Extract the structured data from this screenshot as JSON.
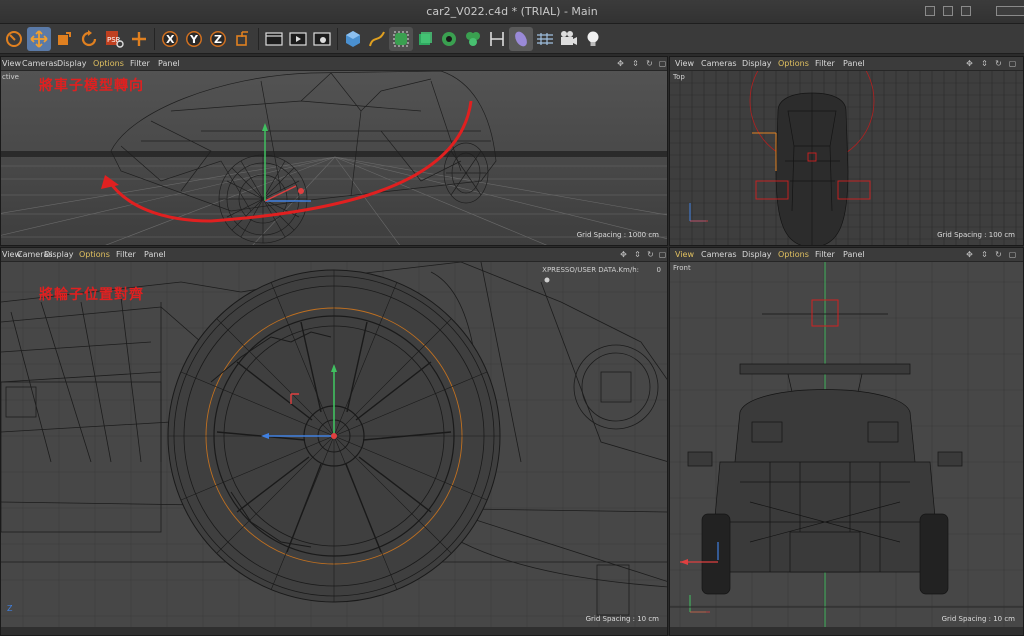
{
  "window": {
    "title": "car2_V022.c4d * (TRIAL) - Main"
  },
  "toolbar": {
    "tools": [
      {
        "name": "live-selection-icon",
        "active": false
      },
      {
        "name": "move-icon",
        "active": true
      },
      {
        "name": "scale-icon",
        "active": false
      },
      {
        "name": "rotate-icon",
        "active": false
      },
      {
        "name": "psr-icon",
        "active": false
      },
      {
        "name": "add-icon",
        "active": false
      },
      {
        "name": "x-axis-icon",
        "label": "X"
      },
      {
        "name": "y-axis-icon",
        "label": "Y"
      },
      {
        "name": "z-axis-icon",
        "label": "Z"
      },
      {
        "name": "coordinate-system-icon"
      },
      {
        "name": "render-view-icon"
      },
      {
        "name": "render-picture-viewer-icon"
      },
      {
        "name": "render-settings-icon"
      },
      {
        "name": "cube-icon"
      },
      {
        "name": "pen-spline-icon"
      },
      {
        "name": "subdivision-icon"
      },
      {
        "name": "array-icon"
      },
      {
        "name": "deformer-icon"
      },
      {
        "name": "mograph-icon"
      },
      {
        "name": "field-icon"
      },
      {
        "name": "material-icon"
      },
      {
        "name": "floor-icon"
      },
      {
        "name": "camera-icon"
      },
      {
        "name": "light-icon"
      }
    ]
  },
  "viewports": {
    "menu": [
      "View",
      "Cameras",
      "Display",
      "Options",
      "Filter",
      "Panel"
    ],
    "perspective": {
      "camera": "ctive",
      "grid_spacing": "Grid Spacing : 1000 cm",
      "annotation": "將車子模型轉向"
    },
    "top": {
      "camera": "Top",
      "grid_spacing": "Grid Spacing : 100 cm"
    },
    "side": {
      "xpresso": "XPRESSO/USER DATA.Km/h:",
      "xpresso_value": "0",
      "grid_spacing": "Grid Spacing : 10 cm",
      "annotation": "將輪子位置對齊",
      "axis_z": "Z"
    },
    "front": {
      "camera": "Front",
      "grid_spacing": "Grid Spacing : 10 cm"
    }
  },
  "colors": {
    "annotation": "#e02020",
    "active_tool": "#5a7aa8",
    "menu_highlight": "#e0c060",
    "axis_x": "#e04040",
    "axis_y": "#40c060",
    "axis_z": "#4080e0",
    "selection_orange": "#d08020"
  }
}
